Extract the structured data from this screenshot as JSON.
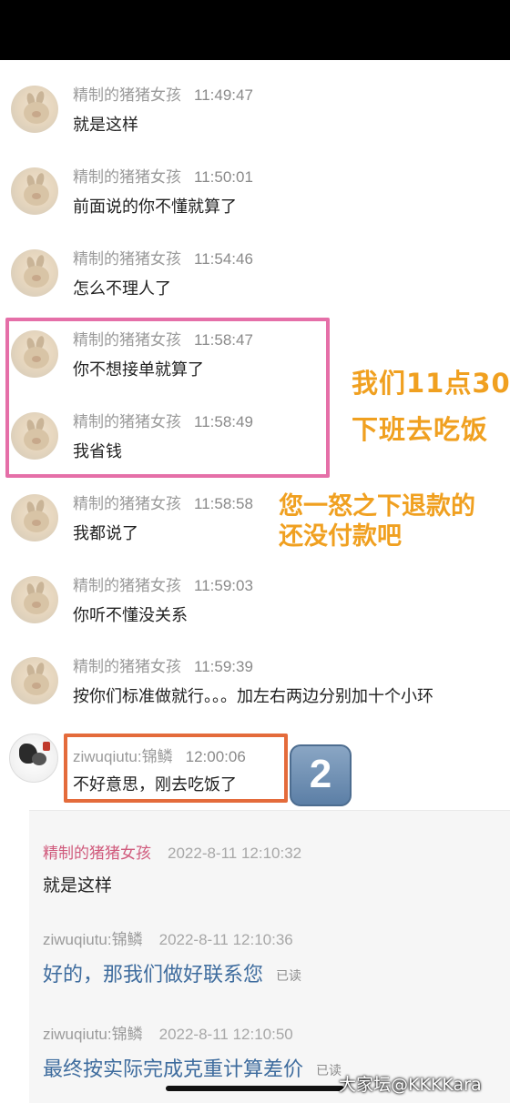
{
  "messages": [
    {
      "name": "精制的猪猪女孩",
      "time": "11:49:47",
      "text": "就是这样"
    },
    {
      "name": "精制的猪猪女孩",
      "time": "11:50:01",
      "text": "前面说的你不懂就算了"
    },
    {
      "name": "精制的猪猪女孩",
      "time": "11:54:46",
      "text": "怎么不理人了"
    },
    {
      "name": "精制的猪猪女孩",
      "time": "11:58:47",
      "text": "你不想接单就算了"
    },
    {
      "name": "精制的猪猪女孩",
      "time": "11:58:49",
      "text": "我省钱"
    },
    {
      "name": "精制的猪猪女孩",
      "time": "11:58:58",
      "text": "我都说了"
    },
    {
      "name": "精制的猪猪女孩",
      "time": "11:59:03",
      "text": "你听不懂没关系"
    },
    {
      "name": "精制的猪猪女孩",
      "time": "11:59:39",
      "text": "按你们标准做就行。。。加左右两边分别加十个小环"
    },
    {
      "name": "ziwuqiutu:锦鳞",
      "time": "12:00:06",
      "text": "不好意思，刚去吃饭了"
    }
  ],
  "annotations": {
    "line1": "我们11点30",
    "line2": "下班去吃饭",
    "line3": "您一怒之下退款的",
    "line4": "还没付款吧"
  },
  "badge": "2",
  "panel": {
    "messages": [
      {
        "name": "精制的猪猪女孩",
        "date": "2022-8-11 12:10:32",
        "text": "就是这样",
        "read": ""
      },
      {
        "name": "ziwuqiutu:锦鳞",
        "date": "2022-8-11 12:10:36",
        "text": "好的，那我们做好联系您",
        "read": "已读"
      },
      {
        "name": "ziwuqiutu:锦鳞",
        "date": "2022-8-11 12:10:50",
        "text": "最终按实际完成克重计算差价",
        "read": "已读"
      }
    ]
  },
  "watermark": "大家坛@KKKKara",
  "colors": {
    "pink_box": "#e56fa8",
    "orange_box": "#e46b3b",
    "annotation": "#f0a020",
    "seller_reply": "#3e6c9e",
    "buyer_name": "#d05a7c"
  }
}
